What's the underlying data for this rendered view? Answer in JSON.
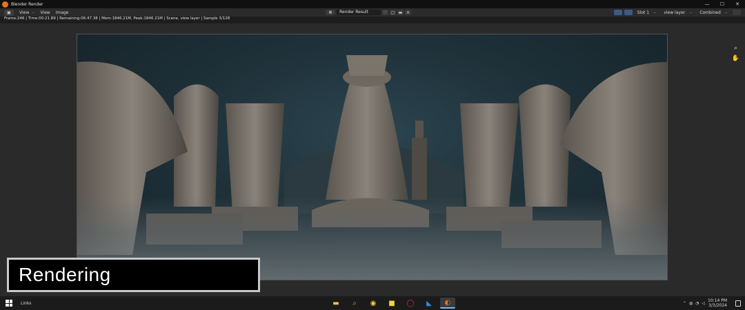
{
  "window": {
    "title": "Blender Render",
    "minimize": "—",
    "maximize": "☐",
    "close": "✕"
  },
  "header": {
    "menus": [
      "View",
      "View",
      "Image"
    ],
    "image_name": "Render Result",
    "slot": "Slot 1",
    "view_layer": "view layer",
    "pass": "Combined"
  },
  "status": {
    "text": "Frame:246 | Time:00:21.89 | Remaining:06:47.38 | Mem:1846.21M, Peak:1846.21M | Scene, view layer | Sample 3/128"
  },
  "overlay": {
    "label": "Rendering"
  },
  "taskbar": {
    "links_label": "Links",
    "time": "10:14 PM",
    "date": "3/3/2024",
    "apps": [
      {
        "name": "file-explorer-icon",
        "glyph": "▬",
        "color": "#f3c24a"
      },
      {
        "name": "search-app-icon",
        "glyph": "⌕",
        "color": "#f28c1e"
      },
      {
        "name": "norton-icon",
        "glyph": "◉",
        "color": "#f5d132"
      },
      {
        "name": "sticky-notes-icon",
        "glyph": "■",
        "color": "#f2d43d"
      },
      {
        "name": "opera-icon",
        "glyph": "◯",
        "color": "#d62e3c"
      },
      {
        "name": "vscode-icon",
        "glyph": "◣",
        "color": "#2f8fe0"
      },
      {
        "name": "blender-icon",
        "glyph": "◐",
        "color": "#e8741a"
      }
    ]
  },
  "colors": {
    "accent": "#e8741a",
    "background": "#2a2a2a",
    "header": "#2b2b2b"
  }
}
